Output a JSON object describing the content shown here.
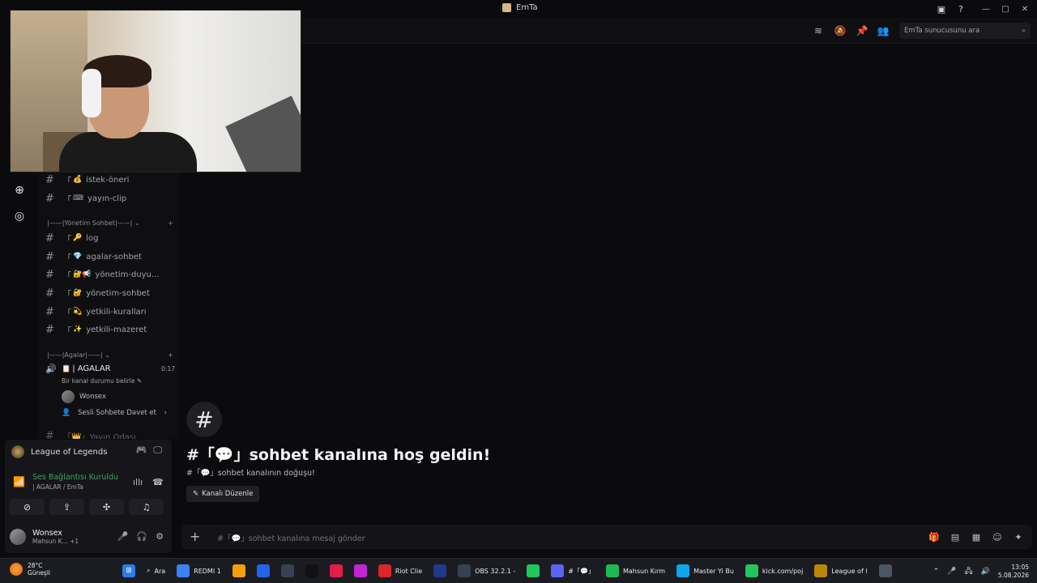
{
  "window": {
    "title": "EmTa"
  },
  "header": {
    "search_placeholder": "EmTa sunucusunu ara"
  },
  "channels": [
    {
      "prefix": "「",
      "emoji": "💰",
      "name": "istek-öneri"
    },
    {
      "prefix": "「",
      "emoji": "⌨",
      "name": "yayın-clip"
    }
  ],
  "categories": {
    "management": "|——|Yönetim Sohbet|——|",
    "agalar": "|——|Agalar|——|"
  },
  "management_channels": [
    {
      "prefix": "「",
      "emoji": "🔑",
      "name": "log"
    },
    {
      "prefix": "「",
      "emoji": "💎",
      "name": "agalar-sohbet"
    },
    {
      "prefix": "「",
      "emoji": "🔐📢",
      "name": "yönetim-duyu..."
    },
    {
      "prefix": "「",
      "emoji": "🔐",
      "name": "yönetim-sohbet"
    },
    {
      "prefix": "「",
      "emoji": "💫",
      "name": "yetkili-kuralları"
    },
    {
      "prefix": "「",
      "emoji": "✨",
      "name": "yetkili-mazeret"
    }
  ],
  "voice_channel": {
    "name": "| AGALAR",
    "timer": "0:17",
    "status_hint": "Bir kanal durumu belirle",
    "member": "Wonsex",
    "invite": "Sesli Sohbete Davet et",
    "next_channel": "「👑」Yayın Odası"
  },
  "welcome": {
    "hash": "#",
    "title": "#「💬」sohbet kanalına hoş geldin!",
    "subtitle": "#「💬」sohbet kanalının doğuşu!",
    "edit_button": "Kanalı Düzenle"
  },
  "composer": {
    "placeholder": "#「💬」sohbet kanalına mesaj gönder"
  },
  "activity": {
    "game": "League of Legends"
  },
  "voice_status": {
    "connected": "Ses Bağlantısı Kuruldu",
    "location": "| AGALAR / EmTa"
  },
  "user": {
    "name": "Wonsex",
    "status": "Mahsun K...",
    "extra": "+1"
  },
  "taskbar": {
    "weather_temp": "28°C",
    "weather_desc": "Güneşli",
    "search": "Ara",
    "apps": [
      {
        "label": "REDMI 1",
        "color": "#3b82f6"
      },
      {
        "label": "",
        "color": "#f59e0b"
      },
      {
        "label": "",
        "color": "#2563eb"
      },
      {
        "label": "",
        "color": "#374151"
      },
      {
        "label": "",
        "color": "#111111"
      },
      {
        "label": "",
        "color": "#e11d48"
      },
      {
        "label": "",
        "color": "#c026d3"
      },
      {
        "label": "Riot Clie",
        "color": "#dc2626"
      },
      {
        "label": "",
        "color": "#1e3a8a"
      },
      {
        "label": "OBS 32.2.1 -",
        "color": "#374151"
      },
      {
        "label": "",
        "color": "#22c55e"
      },
      {
        "label": "#「💬」",
        "color": "#5865f2"
      },
      {
        "label": "Mahsun Kırm",
        "color": "#1db954"
      },
      {
        "label": "Master Yi Bu",
        "color": "#0ea5e9"
      },
      {
        "label": "kick.com/poj",
        "color": "#22c55e"
      },
      {
        "label": "League of l",
        "color": "#b8860b"
      },
      {
        "label": "",
        "color": "#4b5563"
      }
    ],
    "time": "13:05",
    "date": "5.08.2026"
  },
  "colors": {
    "accent": "#5865f2",
    "voice_green": "#3ba55d",
    "background": "#0b0b0d"
  }
}
